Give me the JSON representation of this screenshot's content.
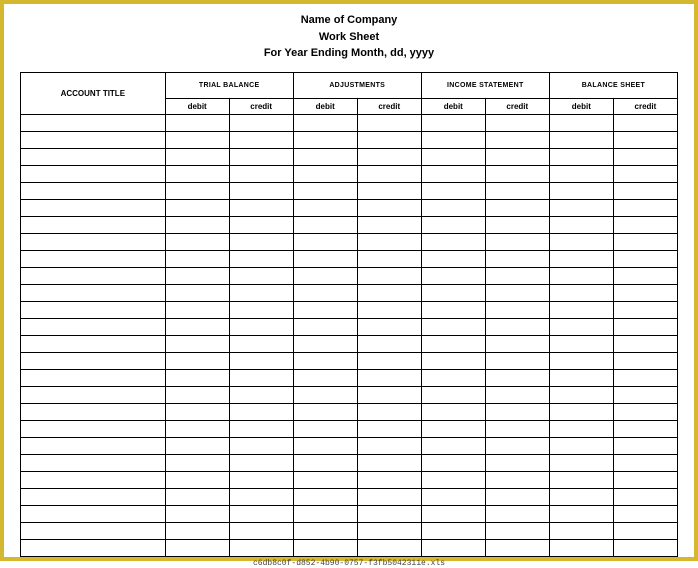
{
  "header": {
    "company": "Name of Company",
    "title": "Work Sheet",
    "period": "For Year Ending Month, dd, yyyy"
  },
  "columns": {
    "account_title": "ACCOUNT TITLE",
    "sections": [
      {
        "name": "TRIAL BALANCE",
        "debit": "debit",
        "credit": "credit"
      },
      {
        "name": "ADJUSTMENTS",
        "debit": "debit",
        "credit": "credit"
      },
      {
        "name": "INCOME STATEMENT",
        "debit": "debit",
        "credit": "credit"
      },
      {
        "name": "BALANCE SHEET",
        "debit": "debit",
        "credit": "credit"
      }
    ]
  },
  "rows": [
    {},
    {},
    {},
    {},
    {},
    {},
    {},
    {},
    {},
    {},
    {},
    {},
    {},
    {},
    {},
    {},
    {},
    {},
    {},
    {},
    {},
    {},
    {},
    {},
    {},
    {}
  ],
  "footer": "c6db8c0f-d852-4b90-0757-f3fb5042311e.xls"
}
